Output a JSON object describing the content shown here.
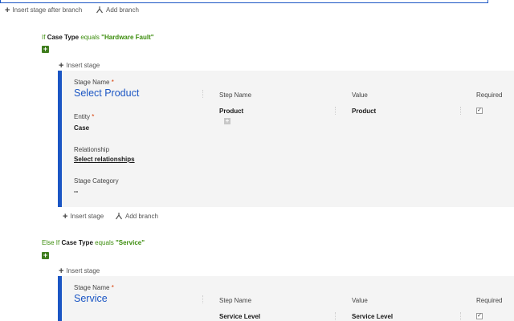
{
  "top_actions": {
    "insert_stage_after_branch": "Insert stage after branch",
    "add_branch": "Add branch"
  },
  "branch1": {
    "condition": {
      "prefix": "If",
      "field": "Case Type",
      "operator": "equals",
      "value": "\"Hardware Fault\""
    },
    "insert_stage": "Insert stage",
    "stage": {
      "stage_name_label": "Stage Name",
      "stage_name": "Select Product",
      "entity_label": "Entity",
      "entity": "Case",
      "relationship_label": "Relationship",
      "relationship_link": "Select relationships",
      "stage_category_label": "Stage Category",
      "stage_category": "--",
      "columns": {
        "step_name": "Step Name",
        "value": "Value",
        "required": "Required"
      },
      "steps": [
        {
          "step_name": "Product",
          "value": "Product",
          "required": true
        }
      ]
    },
    "after_actions": {
      "insert_stage": "Insert stage",
      "add_branch": "Add branch"
    }
  },
  "branch2": {
    "condition": {
      "prefix": "Else If",
      "field": "Case Type",
      "operator": "equals",
      "value": "\"Service\""
    },
    "insert_stage": "Insert stage",
    "stage": {
      "stage_name_label": "Stage Name",
      "stage_name": "Service",
      "columns": {
        "step_name": "Step Name",
        "value": "Value",
        "required": "Required"
      },
      "steps": [
        {
          "step_name": "Service Level",
          "value": "Service Level",
          "required": true
        }
      ]
    }
  },
  "colors": {
    "accent": "#1b56c4",
    "condition_green": "#3c8d0d",
    "required_star": "#d83b01"
  }
}
